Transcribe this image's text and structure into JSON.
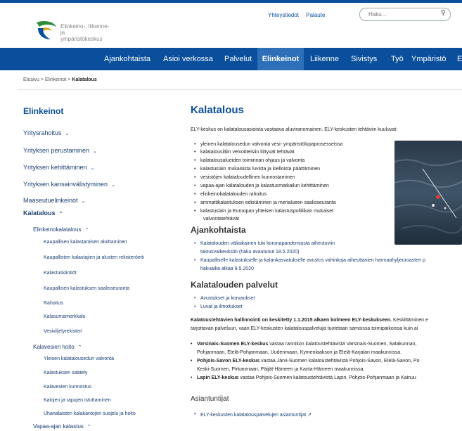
{
  "org": {
    "name_line1": "Elinkeino-, liikenne- ja",
    "name_line2": "ympäristökeskus"
  },
  "util": {
    "contact": "Yhteystiedot",
    "feedback": "Palaute",
    "search_placeholder": "Haku..."
  },
  "nav": [
    "Ajankohtaista",
    "Asioi verkossa",
    "Palvelut",
    "Elinkeinot",
    "Liikenne",
    "Sivistys",
    "Työ",
    "Ympäristö",
    "E"
  ],
  "breadcrumb": {
    "home": "Etusivu",
    "sep": ">",
    "section": "Elinkeinot",
    "current": "Kalatalous"
  },
  "sidebar": {
    "title": "Elinkeinot",
    "items": [
      "Yritysrahoitus",
      "Yrityksen perustaminen",
      "Yrityksen kehittäminen",
      "Yrityksen kansainvälistyminen",
      "Maaseutuelinkeinot",
      "Kalatalous",
      "Elinkeinokalatalous",
      "Kaupallisen kalastamisen aloittaminen",
      "Kaupallisten kalastajien ja alusten rekisteröinti",
      "Kalastuskiintiöt",
      "Kaupallisen kalastuksen saalisseuranta",
      "Rahoitus",
      "Kalasumamerkkalu",
      "Vesiviljelyrekisteri",
      "Kalavesien hoito",
      "Yleisen kalatalousedun valvonta",
      "Kalastuksen säätely",
      "Kalavesien kunnostus",
      "Kalojen ja rapujen istuttaminen",
      "Uhanalaisten kalakantojen suojelu ja hoito",
      "Vapaa-ajan kalastus"
    ]
  },
  "main": {
    "title": "Kalatalous",
    "intro": "ELY-keskus on kalatalousasioista vastaava aluviranomainen. ELY-keskusten tehtäviin kuuluvat:",
    "duties": [
      "yleinen kalatalousedun valvonta vesi- ympäristölupaprosesseissa",
      "kalatalousiltiin velvoitteisiin liittyvät tehtävät",
      "kalatalousalueiden toiminnan ohjaus ja valvonta",
      "kalastuslain mukaisista luvista ja kielloista päättäminen",
      "vesistöjen kalataloudellinen kunnostaminen",
      "vapaa-ajan kalatalouden ja kalastusmatkailun kehittäminen",
      "elinkeinokalatalouden rahoitus",
      "ammattikalastuksen edistäminen ja merialueen saalisseuranta",
      "kalastuslain ja Euroopan yhteisen kalastuspolitiikan mukaiset",
      "valvontatehtävät"
    ],
    "news_title": "Ajankohtaista",
    "news": [
      "Kalatalouden väliaikainen tuki koronapandemiasta aiheutuviin",
      "talousvaikeuksiin (haku avautunut 18.5.2020)",
      "Kaupalliselle kalastukselle ja kalankasvatukselle avustus vahinkoja aiheuttavien harmaahylje­uroasten p",
      "hakuaika alkaa 8.5.2020"
    ],
    "services_title": "Kalatalouden palvelut",
    "services": [
      "Avustukset ja korvaukset",
      "Luvat ja ilmoitukset"
    ],
    "admin_bold": "Kalatoustehtävien hallinnointi on keskitetty 1.1.2015 alkaen kolmeen ELY-keskukseen.",
    "admin_rest": " Keskittäminen e",
    "admin_line2": "tarjottavan palveluun, vaan ELY-keskusten kalatalouspalveluja tuotetaan samoissa toimipaikoissa kuin ai",
    "centers": [
      {
        "bold": "Varsinais-Suomen ELY-keskus",
        "text": " vastaa rannikon kalatoustehtävistä Varsinais-Suomen, Satakunnan,"
      },
      {
        "bold": "",
        "text": "Pohjanmaan, Etelä-Pohjanmaan, Uudenmaan, Kymenlaakson ja Etelä-Karjalan maakunnissa."
      },
      {
        "bold": "Pohjois-Savon ELY-keskus",
        "text": " vastaa Järvi-Suomen kalatoustehtävistä Pohjois-Savon, Etelä-Savon, Po"
      },
      {
        "bold": "",
        "text": "Keski-Suomen, Pirkanmaan, Päijät-Hämeen ja Kanta-Hämeen maakunnissa."
      },
      {
        "bold": "Lapin ELY-keskus",
        "text": " vastaa Pohjois-Suomen kalatoustehtävistä Lapin, Pohjois-Pohjanmaan ja Kainuu"
      }
    ],
    "experts_title": "Asiantuntijat",
    "experts_link": "ELY-keskusten kalatalouspalvelujen asiantuntijat",
    "external_icon": "external-link-icon"
  },
  "colors": {
    "brand": "#0a4f9c",
    "nav_active": "#2d6fb8"
  }
}
